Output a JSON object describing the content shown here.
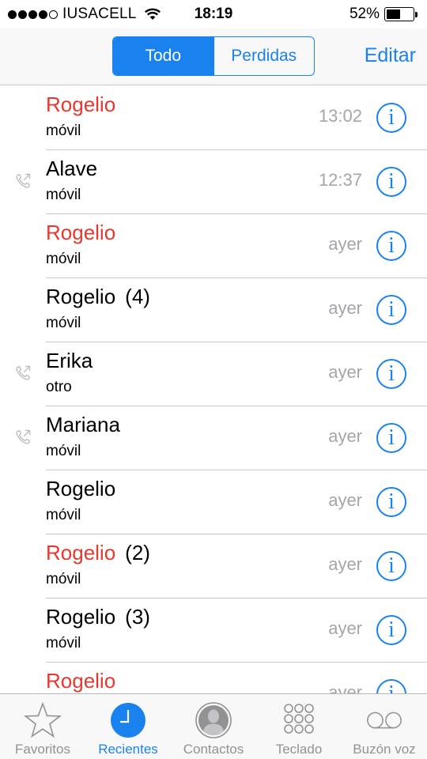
{
  "status_bar": {
    "carrier": "IUSACELL",
    "time": "18:19",
    "battery": "52%",
    "battery_level": 0.52,
    "signal_bars": 4,
    "signal_max": 5,
    "wifi_icon": "wifi-icon"
  },
  "nav": {
    "segments": [
      "Todo",
      "Perdidas"
    ],
    "active_segment": "Todo",
    "edit_label": "Editar"
  },
  "calls": [
    {
      "name": "Rogelio",
      "count": "",
      "type": "móvil",
      "time": "13:02",
      "missed": true,
      "outgoing": false
    },
    {
      "name": "Alave",
      "count": "",
      "type": "móvil",
      "time": "12:37",
      "missed": false,
      "outgoing": true
    },
    {
      "name": "Rogelio",
      "count": "",
      "type": "móvil",
      "time": "ayer",
      "missed": true,
      "outgoing": false
    },
    {
      "name": "Rogelio",
      "count": "(4)",
      "type": "móvil",
      "time": "ayer",
      "missed": false,
      "outgoing": false
    },
    {
      "name": "Erika",
      "count": "",
      "type": "otro",
      "time": "ayer",
      "missed": false,
      "outgoing": true
    },
    {
      "name": "Mariana",
      "count": "",
      "type": "móvil",
      "time": "ayer",
      "missed": false,
      "outgoing": true
    },
    {
      "name": "Rogelio",
      "count": "",
      "type": "móvil",
      "time": "ayer",
      "missed": false,
      "outgoing": false
    },
    {
      "name": "Rogelio",
      "count": "(2)",
      "type": "móvil",
      "time": "ayer",
      "missed": true,
      "outgoing": false
    },
    {
      "name": "Rogelio",
      "count": "(3)",
      "type": "móvil",
      "time": "ayer",
      "missed": false,
      "outgoing": false
    },
    {
      "name": "Rogelio",
      "count": "",
      "type": "",
      "time": "ayer",
      "missed": true,
      "outgoing": false
    }
  ],
  "tabs": [
    {
      "label": "Favoritos",
      "icon": "star-icon",
      "active": false
    },
    {
      "label": "Recientes",
      "icon": "clock-icon",
      "active": true
    },
    {
      "label": "Contactos",
      "icon": "contact-icon",
      "active": false
    },
    {
      "label": "Teclado",
      "icon": "keypad-icon",
      "active": false
    },
    {
      "label": "Buzón voz",
      "icon": "voicemail-icon",
      "active": false
    }
  ],
  "colors": {
    "accent": "#1a82ef",
    "missed": "#e6382f",
    "secondary_text": "#a5a5aa",
    "inactive_tab": "#929292"
  }
}
